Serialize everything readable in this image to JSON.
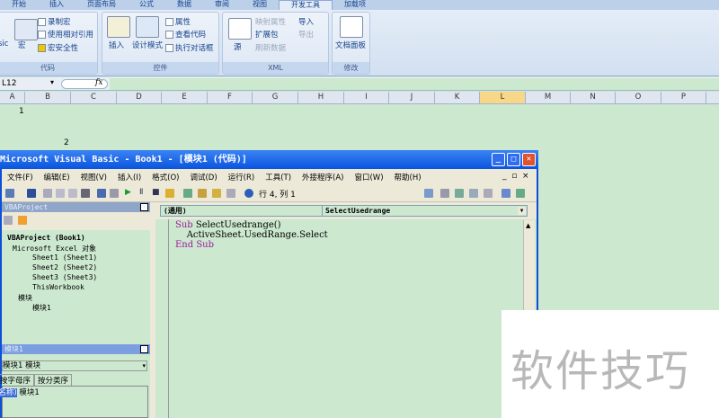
{
  "ribbon": {
    "tabs": [
      "开始",
      "插入",
      "页面布局",
      "公式",
      "数据",
      "审阅",
      "视图",
      "开发工具",
      "加载项"
    ],
    "active_tab": "开发工具",
    "code_group": {
      "label": "代码",
      "visual_basic": "sic",
      "macros": "宏",
      "record_macro": "录制宏",
      "relative_ref": "使用相对引用",
      "macro_security": "宏安全性"
    },
    "controls_group": {
      "label": "控件",
      "insert": "插入",
      "design_mode": "设计模式",
      "properties": "属性",
      "view_code": "查看代码",
      "run_dialog": "执行对话框"
    },
    "xml_group": {
      "label": "XML",
      "source": "源",
      "map_properties": "映射属性",
      "expansion_packs": "扩展包",
      "refresh_data": "刷新数据",
      "import": "导入",
      "export": "导出"
    },
    "modify_group": {
      "label": "修改",
      "document_panel": "文档面板"
    }
  },
  "formula_bar": {
    "name_box": "L12",
    "fx": "fx"
  },
  "columns": [
    "A",
    "B",
    "C",
    "D",
    "E",
    "F",
    "G",
    "H",
    "I",
    "J",
    "K",
    "L",
    "M",
    "N",
    "O",
    "P"
  ],
  "cells": {
    "row1": "1",
    "row2": "2"
  },
  "vbe": {
    "title": "Microsoft Visual Basic - Book1 - [模块1 (代码)]",
    "menu": [
      "文件(F)",
      "编辑(E)",
      "视图(V)",
      "插入(I)",
      "格式(O)",
      "调试(D)",
      "运行(R)",
      "工具(T)",
      "外接程序(A)",
      "窗口(W)",
      "帮助(H)"
    ],
    "position": "行 4, 列 1",
    "project": {
      "title": "VBAProject",
      "root": "VBAProject (Book1)",
      "excel_objects": "Microsoft Excel 对象",
      "items": [
        "Sheet1 (Sheet1)",
        "Sheet2 (Sheet2)",
        "Sheet3 (Sheet3)",
        "ThisWorkbook"
      ],
      "modules": "模块",
      "module1": "模块1"
    },
    "properties": {
      "title": "模块1",
      "object": "模块1 模块",
      "tabs": [
        "按字母序",
        "按分类序"
      ],
      "name_key": "(名称)",
      "name_value": "模块1"
    },
    "code": {
      "object": "(通用)",
      "procedure": "SelectUsedrange",
      "lines": [
        [
          "Sub",
          " SelectUsedrange()"
        ],
        [
          "",
          "    ActiveSheet.UsedRange.Select"
        ],
        [
          "End Sub",
          ""
        ]
      ]
    }
  },
  "watermark": "软件技巧"
}
